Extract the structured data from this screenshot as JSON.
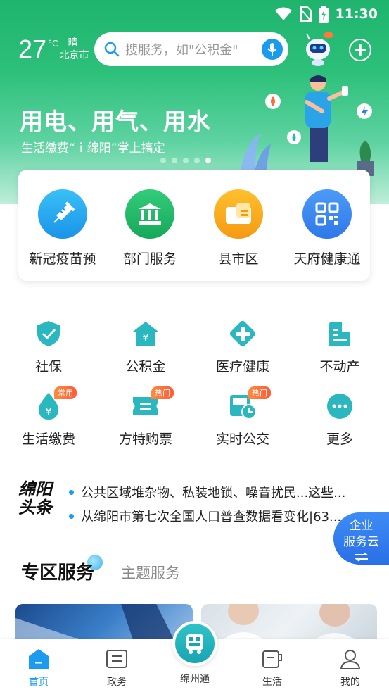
{
  "status_bar": {
    "time": "11:30"
  },
  "weather": {
    "temperature": "27",
    "unit": "°C",
    "condition": "晴",
    "city": "北京市"
  },
  "search": {
    "placeholder": "搜服务，如\"公积金\""
  },
  "banner": {
    "title": "用电、用气、用水",
    "subtitle": "生活缴费“ｉ绵阳”掌上搞定",
    "page_count": 5,
    "active_page": 5
  },
  "quick_services": [
    {
      "label": "新冠疫苗预",
      "icon": "syringe-icon",
      "color": "#28a8ef"
    },
    {
      "label": "部门服务",
      "icon": "building-icon",
      "color": "#1fb86a"
    },
    {
      "label": "县市区",
      "icon": "map-card-icon",
      "color": "#f7a51c"
    },
    {
      "label": "天府健康通",
      "icon": "qr-code-icon",
      "color": "#3a88f0"
    }
  ],
  "grid_services": [
    {
      "label": "社保",
      "icon": "shield-check-icon",
      "tag": ""
    },
    {
      "label": "公积金",
      "icon": "house-yen-icon",
      "tag": ""
    },
    {
      "label": "医疗健康",
      "icon": "medical-cross-icon",
      "tag": ""
    },
    {
      "label": "不动产",
      "icon": "property-icon",
      "tag": ""
    },
    {
      "label": "生活缴费",
      "icon": "yen-drop-icon",
      "tag": "常用"
    },
    {
      "label": "方特购票",
      "icon": "ticket-icon",
      "tag": "热门"
    },
    {
      "label": "实时公交",
      "icon": "bus-clock-icon",
      "tag": "热门"
    },
    {
      "label": "更多",
      "icon": "more-dots-icon",
      "tag": ""
    }
  ],
  "news": {
    "logo_line1": "绵阳",
    "logo_line2": "头条",
    "items": [
      "公共区域堆杂物、私装地锁、噪音扰民...这些...",
      "从绵阳市第七次全国人口普查数据看变化|63..."
    ]
  },
  "floating": {
    "line1": "企业",
    "line2": "服务云"
  },
  "section": {
    "title": "专区服务",
    "alt_title": "主题服务"
  },
  "tabbar": {
    "tabs": [
      {
        "label": "首页",
        "icon": "home-icon",
        "active": true
      },
      {
        "label": "政务",
        "icon": "gov-icon",
        "active": false
      },
      {
        "label": "绵州通",
        "icon": "scan-bus-icon",
        "active": false
      },
      {
        "label": "生活",
        "icon": "life-cup-icon",
        "active": false
      },
      {
        "label": "我的",
        "icon": "profile-icon",
        "active": false
      }
    ]
  },
  "colors": {
    "brand_green": "#1fb46e",
    "accent_blue": "#1a9bf0",
    "tag_orange": "#ff6b3a",
    "grid_icon": "#2ab7bf"
  }
}
